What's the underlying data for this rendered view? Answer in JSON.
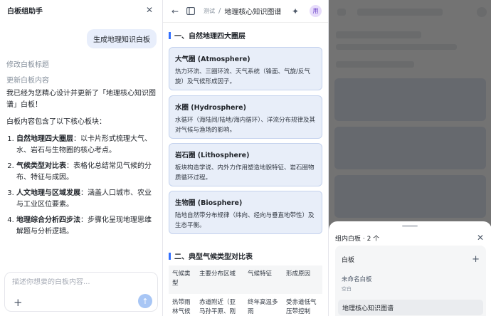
{
  "assistant": {
    "title": "白板组助手",
    "user_message": "生成地理知识白板",
    "history": [
      "修改白板标题",
      "更新白板内容"
    ],
    "intro": "我已经为您精心设计并更新了「地理核心知识图谱」白板！",
    "lead": "白板内容包含了以下核心板块：",
    "points": [
      {
        "head": "自然地理四大圈层",
        "body": "：以卡片形式梳理大气、水、岩石与生物圈的核心考点。"
      },
      {
        "head": "气候类型对比表",
        "body": "：表格化总结常见气候的分布、特征与成因。"
      },
      {
        "head": "人文地理与区域发展",
        "body": "：涵盖人口城市、农业与工业区位要素。"
      },
      {
        "head": "地理综合分析四步法",
        "body": "：步骤化呈现地理思维解题与分析逻辑。"
      }
    ],
    "composer_placeholder": "描述你想要的白板内容..."
  },
  "board": {
    "crumb_parent": "测试",
    "crumb_sep": "/",
    "title": "地理核心知识图谱",
    "avatar": "用",
    "section1": "一、自然地理四大圈层",
    "cards": [
      {
        "title": "大气圈 (Atmosphere)",
        "desc": "热力环流、三圈环流、天气系统（锋面、气旋/反气旋）及气候形成因子。"
      },
      {
        "title": "水圈 (Hydrosphere)",
        "desc": "水循环（海陆间/陆地/海内循环）、洋流分布规律及其对气候与渔场的影响。"
      },
      {
        "title": "岩石圈 (Lithosphere)",
        "desc": "板块构造学说、内外力作用塑造地貌特征、岩石圈物质循环过程。"
      },
      {
        "title": "生物圈 (Biosphere)",
        "desc": "陆地自然带分布规律（纬向、经向与垂直地带性）及生态平衡。"
      }
    ],
    "section2": "二、典型气候类型对比表",
    "table_headers": [
      "气候类型",
      "主要分布区域",
      "气候特征",
      "形成原因"
    ],
    "table_rows": [
      [
        "热带雨林气候",
        "赤道附近（亚马孙平原、刚果盆地）",
        "终年高温多雨",
        "受赤道低气压带控制"
      ]
    ]
  },
  "sheet": {
    "title": "组内白板 · 2 个",
    "group_label": "白板",
    "items": [
      {
        "name": "未命名白板",
        "sub": "空白"
      },
      {
        "name": "地理核心知识图谱"
      }
    ]
  }
}
